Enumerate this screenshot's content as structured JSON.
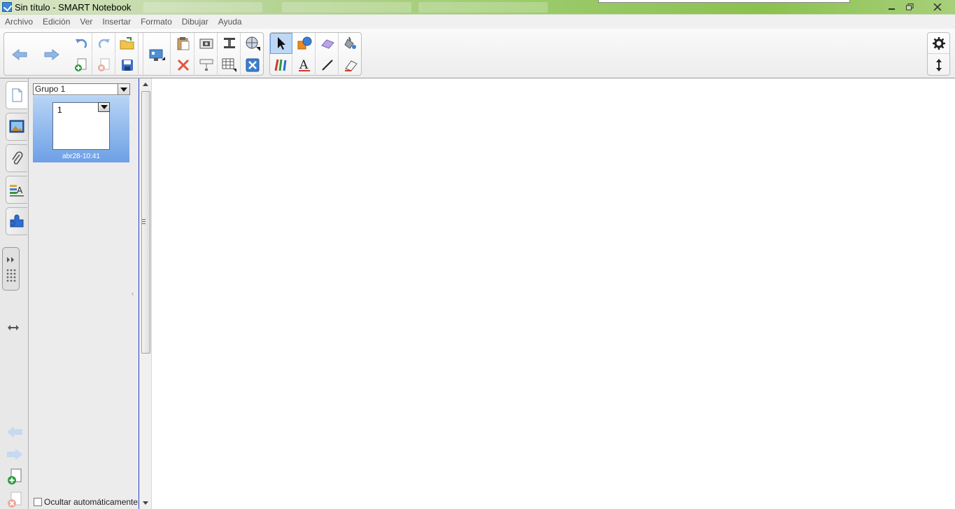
{
  "window": {
    "title": "Sin título - SMART Notebook",
    "minimize_icon": "minimize-icon",
    "maximize_icon": "restore-icon",
    "close_icon": "close-icon"
  },
  "menu": {
    "items": [
      "Archivo",
      "Edición",
      "Ver",
      "Insertar",
      "Formato",
      "Dibujar",
      "Ayuda"
    ]
  },
  "toolbar": {
    "icons": [
      "back-arrow-icon",
      "forward-arrow-icon",
      "undo-icon",
      "redo-icon",
      "open-file-icon",
      "new-page-icon",
      "delete-page-icon",
      "save-icon",
      "screen-shade-icon",
      "paste-icon",
      "screen-capture-icon",
      "document-camera-icon",
      "measurement-tools-icon",
      "delete-icon",
      "table-icon",
      "clear-page-icon",
      "select-icon",
      "shapes-icon",
      "magic-pen-icon",
      "fill-icon",
      "pens-icon",
      "text-icon",
      "lines-icon",
      "eraser-icon",
      "settings-icon",
      "move-toolbar-icon"
    ]
  },
  "sidebar": {
    "tabs": [
      "page-sorter-icon",
      "gallery-icon",
      "attachments-icon",
      "properties-icon",
      "addons-icon"
    ]
  },
  "sorter": {
    "group_label": "Grupo 1",
    "page_number": "1",
    "page_date": "abr28-10:41",
    "autohide_label": "Ocultar automáticamente"
  },
  "colors": {
    "accent_blue": "#6ea0e6",
    "scroll_border": "#2a3cc7",
    "delete_red": "#e8523f"
  }
}
